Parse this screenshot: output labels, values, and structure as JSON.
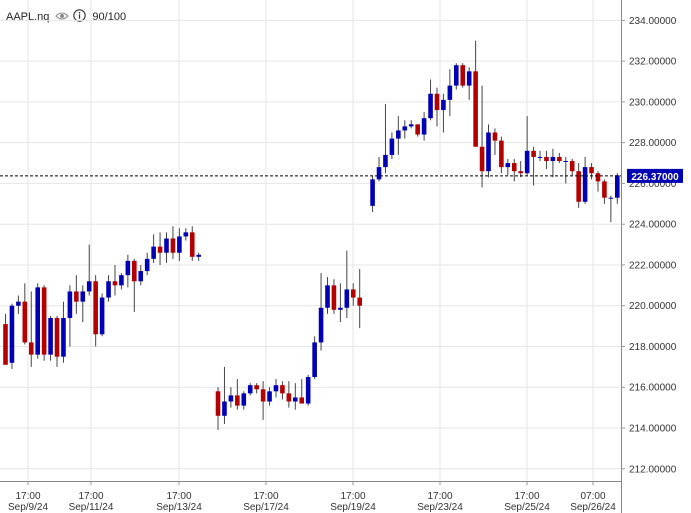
{
  "header": {
    "symbol": "AAPL.nq",
    "eye_icon": "eye-icon",
    "info_icon": "info-icon",
    "quality": "90/100"
  },
  "colors": {
    "up": "#0000b4",
    "down": "#b40000",
    "grid": "#e6e6e6",
    "axis_text": "#333333",
    "price_tag_bg": "#0000b4",
    "price_tag_text": "#ffffff",
    "price_line": "#000000"
  },
  "chart_data": {
    "type": "candlestick",
    "title": "",
    "xlabel": "",
    "ylabel": "",
    "ylim": [
      211.4,
      235.0
    ],
    "yticks": [
      "212.00000",
      "214.00000",
      "216.00000",
      "218.00000",
      "220.00000",
      "222.00000",
      "224.00000",
      "226.00000",
      "228.00000",
      "230.00000",
      "232.00000",
      "234.00000"
    ],
    "xticks": [
      {
        "time": "17:00",
        "date": "Sep/9/24"
      },
      {
        "time": "17:00",
        "date": "Sep/11/24"
      },
      {
        "time": "17:00",
        "date": "Sep/13/24"
      },
      {
        "time": "17:00",
        "date": "Sep/17/24"
      },
      {
        "time": "17:00",
        "date": "Sep/19/24"
      },
      {
        "time": "17:00",
        "date": "Sep/23/24"
      },
      {
        "time": "17:00",
        "date": "Sep/25/24"
      },
      {
        "time": "07:00",
        "date": "Sep/26/24"
      }
    ],
    "current_price": "226.37000",
    "current_value": 226.37,
    "grid": true,
    "candles": [
      [
        219.1,
        219.6,
        217.3,
        217.1
      ],
      [
        217.2,
        220.1,
        216.9,
        220.0
      ],
      [
        220.0,
        220.5,
        219.6,
        220.2
      ],
      [
        220.2,
        221.1,
        218.1,
        218.2
      ],
      [
        218.2,
        220.7,
        217.0,
        217.6
      ],
      [
        217.6,
        221.1,
        217.4,
        220.9
      ],
      [
        220.9,
        221.0,
        217.3,
        217.6
      ],
      [
        217.6,
        219.5,
        217.3,
        219.4
      ],
      [
        219.4,
        219.5,
        217.0,
        217.5
      ],
      [
        217.5,
        220.2,
        217.2,
        219.4
      ],
      [
        219.4,
        221.0,
        218.0,
        220.7
      ],
      [
        220.7,
        221.5,
        219.6,
        220.2
      ],
      [
        220.2,
        221.0,
        219.2,
        220.7
      ],
      [
        220.7,
        223.0,
        220.5,
        221.2
      ],
      [
        221.2,
        221.5,
        218.0,
        218.6
      ],
      [
        218.6,
        220.6,
        218.5,
        220.4
      ],
      [
        220.4,
        221.5,
        220.2,
        221.2
      ],
      [
        221.2,
        222.0,
        220.5,
        221.0
      ],
      [
        221.0,
        221.6,
        220.8,
        221.5
      ],
      [
        221.5,
        222.5,
        220.9,
        222.2
      ],
      [
        222.2,
        222.3,
        219.7,
        221.2
      ],
      [
        221.2,
        222.0,
        221.0,
        221.7
      ],
      [
        221.7,
        222.6,
        221.5,
        222.3
      ],
      [
        222.3,
        223.5,
        222.1,
        222.9
      ],
      [
        222.9,
        223.6,
        222.0,
        222.6
      ],
      [
        222.6,
        223.6,
        222.1,
        223.3
      ],
      [
        223.3,
        223.9,
        222.3,
        222.6
      ],
      [
        222.6,
        223.8,
        222.2,
        223.4
      ],
      [
        223.4,
        223.8,
        223.2,
        223.6
      ],
      [
        223.6,
        223.9,
        222.2,
        222.4
      ],
      [
        222.4,
        222.6,
        222.2,
        222.5
      ],
      [
        null,
        null,
        null,
        null
      ],
      [
        null,
        null,
        null,
        null
      ],
      [
        215.8,
        216.0,
        213.9,
        214.6
      ],
      [
        214.6,
        217.0,
        214.2,
        215.3
      ],
      [
        215.3,
        216.0,
        215.0,
        215.6
      ],
      [
        215.6,
        216.4,
        214.9,
        215.1
      ],
      [
        215.1,
        215.8,
        214.9,
        215.7
      ],
      [
        215.7,
        216.2,
        215.6,
        216.1
      ],
      [
        216.1,
        216.2,
        215.7,
        215.9
      ],
      [
        215.9,
        216.3,
        214.4,
        215.3
      ],
      [
        215.3,
        216.0,
        215.1,
        215.8
      ],
      [
        215.8,
        216.4,
        215.5,
        216.1
      ],
      [
        216.1,
        216.3,
        215.4,
        215.7
      ],
      [
        215.7,
        216.3,
        215.0,
        215.3
      ],
      [
        215.3,
        216.2,
        214.9,
        215.5
      ],
      [
        215.5,
        216.4,
        215.2,
        215.2
      ],
      [
        215.2,
        216.6,
        215.1,
        216.5
      ],
      [
        216.5,
        218.5,
        216.4,
        218.2
      ],
      [
        218.2,
        221.6,
        217.8,
        219.9
      ],
      [
        219.9,
        221.4,
        219.6,
        221.0
      ],
      [
        221.0,
        221.3,
        219.6,
        219.8
      ],
      [
        219.8,
        221.1,
        219.2,
        219.9
      ],
      [
        219.9,
        222.7,
        219.4,
        220.8
      ],
      [
        220.8,
        221.1,
        220.0,
        220.4
      ],
      [
        220.4,
        221.8,
        218.9,
        220.0
      ],
      [
        null,
        null,
        null,
        null
      ],
      [
        224.9,
        226.4,
        224.6,
        226.2
      ],
      [
        226.2,
        227.3,
        226.1,
        226.8
      ],
      [
        226.8,
        229.9,
        226.5,
        227.4
      ],
      [
        227.4,
        228.5,
        227.2,
        228.2
      ],
      [
        228.2,
        229.3,
        227.4,
        228.6
      ],
      [
        228.6,
        229.1,
        228.2,
        228.8
      ],
      [
        228.8,
        229.1,
        228.7,
        228.9
      ],
      [
        228.9,
        228.9,
        228.3,
        228.4
      ],
      [
        228.4,
        229.5,
        228.1,
        229.2
      ],
      [
        229.2,
        231.1,
        229.1,
        230.4
      ],
      [
        230.4,
        230.7,
        228.8,
        229.6
      ],
      [
        229.6,
        230.4,
        228.5,
        230.1
      ],
      [
        230.1,
        231.6,
        229.3,
        230.8
      ],
      [
        230.8,
        231.9,
        230.6,
        231.8
      ],
      [
        231.8,
        231.9,
        230.7,
        230.8
      ],
      [
        230.8,
        231.7,
        230.1,
        231.5
      ],
      [
        231.5,
        233.0,
        229.2,
        227.8
      ],
      [
        227.8,
        230.8,
        225.8,
        226.6
      ],
      [
        226.6,
        228.9,
        226.3,
        228.5
      ],
      [
        228.5,
        228.7,
        227.4,
        228.1
      ],
      [
        228.1,
        228.3,
        226.5,
        226.8
      ],
      [
        226.8,
        227.2,
        226.4,
        227.0
      ],
      [
        227.0,
        227.2,
        226.1,
        226.6
      ],
      [
        226.6,
        227.1,
        226.3,
        226.5
      ],
      [
        226.5,
        229.3,
        226.4,
        227.6
      ],
      [
        227.6,
        227.8,
        225.9,
        227.3
      ],
      [
        227.3,
        227.6,
        227.1,
        227.3
      ],
      [
        227.3,
        227.6,
        226.7,
        227.1
      ],
      [
        227.1,
        227.7,
        226.3,
        227.3
      ],
      [
        227.3,
        227.5,
        227.0,
        227.1
      ],
      [
        227.1,
        227.3,
        226.0,
        227.1
      ],
      [
        227.1,
        227.2,
        226.4,
        226.6
      ],
      [
        226.6,
        227.0,
        224.8,
        225.1
      ],
      [
        225.1,
        227.3,
        225.0,
        226.8
      ],
      [
        226.8,
        227.0,
        226.2,
        226.5
      ],
      [
        226.5,
        226.6,
        225.6,
        226.1
      ],
      [
        226.1,
        226.2,
        225.0,
        225.3
      ],
      [
        225.3,
        225.4,
        224.1,
        225.3
      ],
      [
        225.3,
        226.5,
        225.0,
        226.4
      ]
    ]
  }
}
